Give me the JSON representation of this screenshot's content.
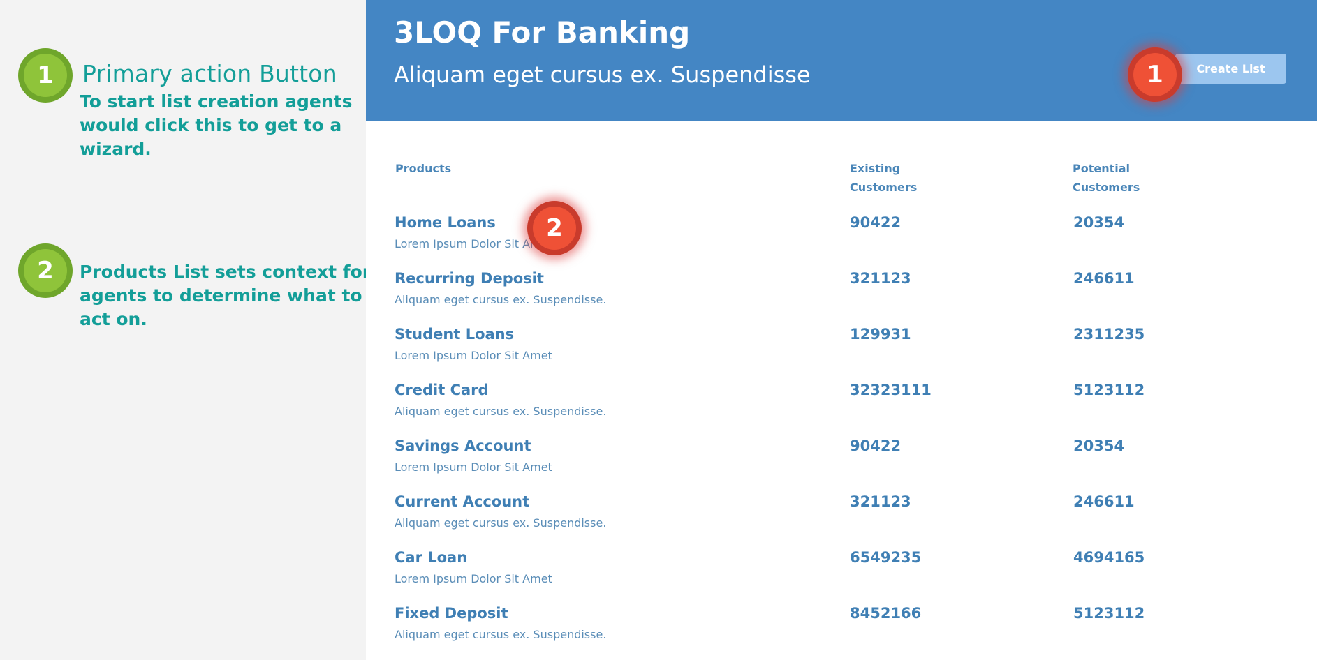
{
  "annotations": [
    {
      "number": "1",
      "heading": "Primary action Button",
      "text": "To start list creation agents would click this to get to a wizard."
    },
    {
      "number": "2",
      "heading": "",
      "text": "Products List sets context for agents to determine what to act on."
    }
  ],
  "header": {
    "title": "3LOQ For Banking",
    "subtitle": "Aliquam eget cursus ex. Suspendisse",
    "create_button_label": "Create List",
    "create_button_color": "#9cc6ef",
    "background_color": "#4486c4"
  },
  "table": {
    "columns": {
      "products": "Products",
      "existing": "Existing Customers",
      "potential": "Potential Customers"
    },
    "rows": [
      {
        "name": "Home Loans",
        "desc": "Lorem Ipsum Dolor Sit Amet",
        "existing": "90422",
        "potential": "20354"
      },
      {
        "name": "Recurring Deposit",
        "desc": "Aliquam eget cursus ex. Suspendisse.",
        "existing": "321123",
        "potential": "246611"
      },
      {
        "name": "Student Loans",
        "desc": "Lorem Ipsum Dolor Sit Amet",
        "existing": "129931",
        "potential": "2311235"
      },
      {
        "name": "Credit Card",
        "desc": "Aliquam eget cursus ex. Suspendisse.",
        "existing": "32323111",
        "potential": "5123112"
      },
      {
        "name": "Savings Account",
        "desc": "Lorem Ipsum Dolor Sit Amet",
        "existing": "90422",
        "potential": "20354"
      },
      {
        "name": "Current Account",
        "desc": "Aliquam eget cursus ex. Suspendisse.",
        "existing": "321123",
        "potential": "246611"
      },
      {
        "name": "Car Loan",
        "desc": "Lorem Ipsum Dolor Sit Amet",
        "existing": "6549235",
        "potential": "4694165"
      },
      {
        "name": "Fixed Deposit",
        "desc": "Aliquam eget cursus ex. Suspendisse.",
        "existing": "8452166",
        "potential": "5123112"
      }
    ]
  },
  "markers": [
    {
      "number": "1"
    },
    {
      "number": "2"
    }
  ]
}
